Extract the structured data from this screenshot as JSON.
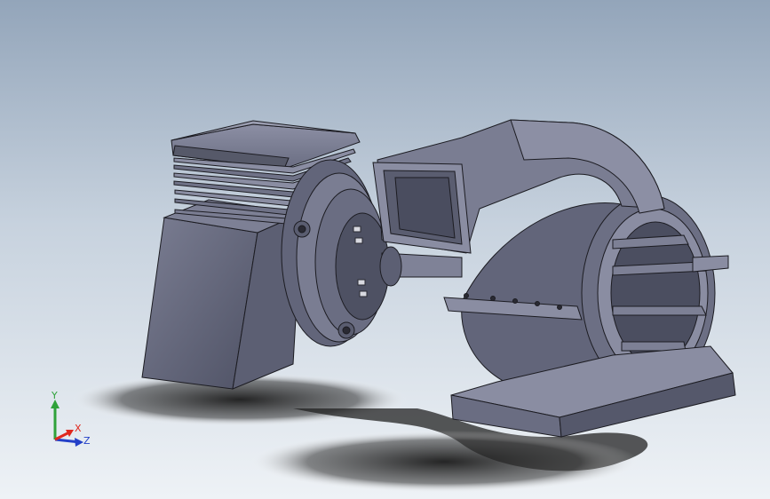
{
  "triad": {
    "x_label": "X",
    "y_label": "Y",
    "z_label": "Z",
    "x_color": "#e0281e",
    "y_color": "#2fa23a",
    "z_color": "#2340c8"
  },
  "model": {
    "body_color": "#6a6d82",
    "edge_color": "#1c1c22"
  }
}
